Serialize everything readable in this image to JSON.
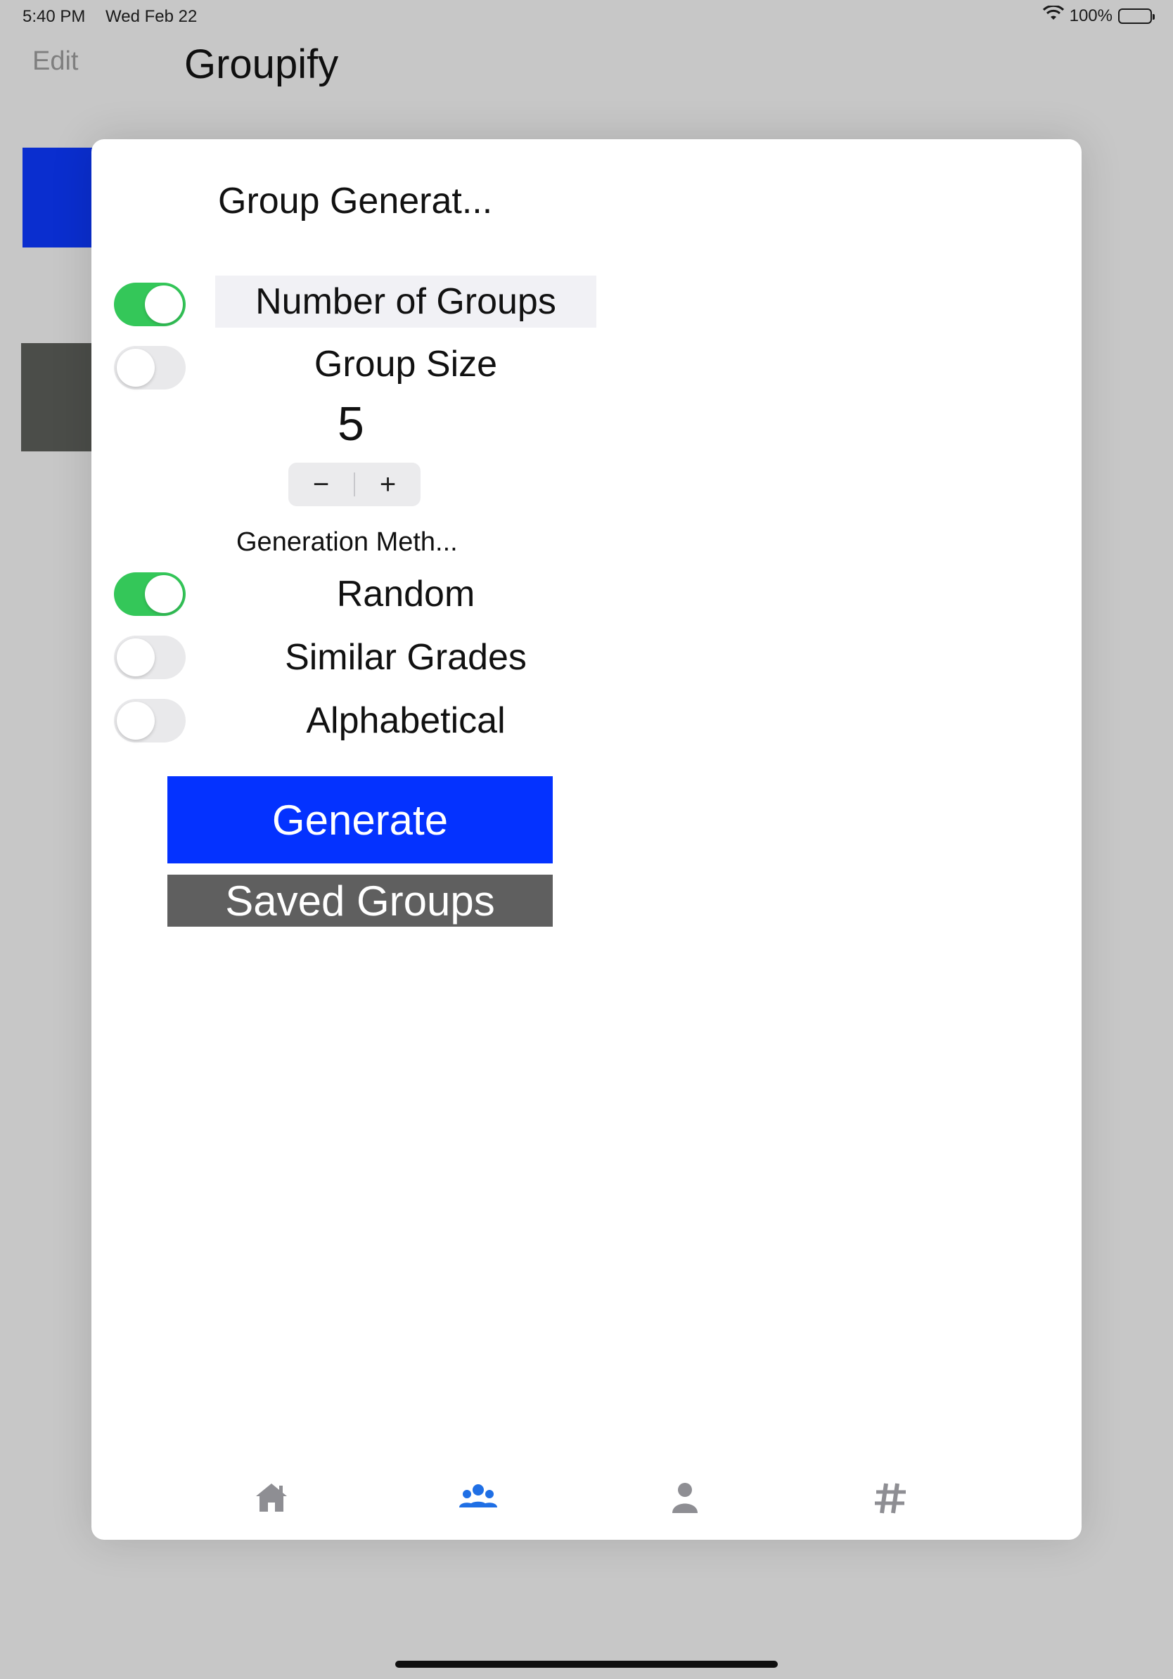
{
  "status_bar": {
    "time": "5:40 PM",
    "date": "Wed Feb 22",
    "battery": "100%",
    "wifi_icon": "wifi-icon",
    "battery_icon": "battery-icon"
  },
  "nav": {
    "edit_label": "Edit",
    "title": "Groupify"
  },
  "modal": {
    "title": "Group Generat...",
    "grouping": {
      "options": [
        {
          "label": "Number of Groups",
          "enabled": true
        },
        {
          "label": "Group Size",
          "enabled": false
        }
      ]
    },
    "stepper": {
      "value": "5",
      "decrement_label": "−",
      "increment_label": "+"
    },
    "method_caption": "Generation Meth...",
    "methods": [
      {
        "label": "Random",
        "enabled": true
      },
      {
        "label": "Similar Grades",
        "enabled": false
      },
      {
        "label": "Alphabetical",
        "enabled": false
      }
    ],
    "generate_label": "Generate",
    "saved_label": "Saved Groups"
  },
  "tabs": [
    {
      "icon": "home-icon",
      "active": false
    },
    {
      "icon": "groups-icon",
      "active": true
    },
    {
      "icon": "person-icon",
      "active": false
    },
    {
      "icon": "hashtag-icon",
      "active": false
    }
  ],
  "colors": {
    "toggle_on": "#34c759",
    "toggle_off": "#e9e9eb",
    "generate": "#0432ff",
    "saved": "#5f5f5f",
    "active_tab": "#1f6fe5",
    "inactive_tab": "#8e8e93"
  }
}
